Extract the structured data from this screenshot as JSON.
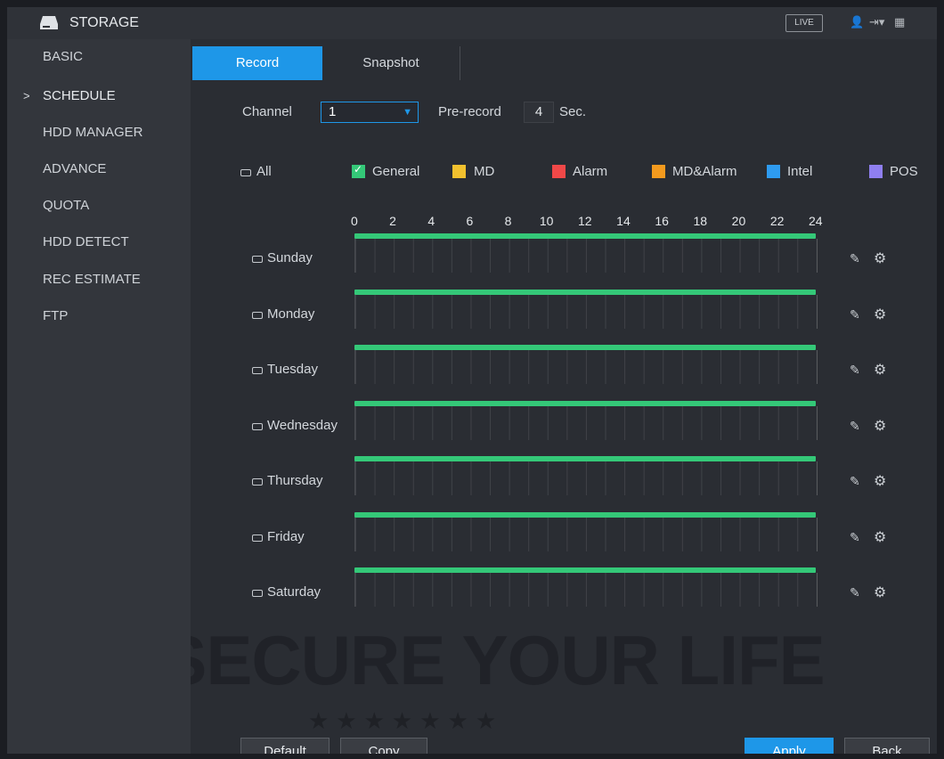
{
  "titlebar": {
    "title": "STORAGE",
    "live_label": "LIVE"
  },
  "sidebar": {
    "items": [
      {
        "label": "BASIC"
      },
      {
        "label": "SCHEDULE",
        "active": true
      },
      {
        "label": "HDD MANAGER"
      },
      {
        "label": "ADVANCE"
      },
      {
        "label": "QUOTA"
      },
      {
        "label": "HDD DETECT"
      },
      {
        "label": "REC ESTIMATE"
      },
      {
        "label": "FTP"
      }
    ],
    "active_marker": ">"
  },
  "tabs": [
    {
      "label": "Record",
      "active": true
    },
    {
      "label": "Snapshot"
    }
  ],
  "controls": {
    "channel_label": "Channel",
    "channel_value": "1",
    "prerecord_label": "Pre-record",
    "prerecord_value": "4",
    "prerecord_unit": "Sec."
  },
  "legend": {
    "all_label": "All",
    "items": [
      {
        "label": "General",
        "color": "#34c878",
        "checked": true
      },
      {
        "label": "MD",
        "color": "#f2c12e"
      },
      {
        "label": "Alarm",
        "color": "#f04848"
      },
      {
        "label": "MD&Alarm",
        "color": "#f39a1e"
      },
      {
        "label": "Intel",
        "color": "#2e9bf0"
      },
      {
        "label": "POS",
        "color": "#8f7ff0"
      }
    ]
  },
  "timeline": {
    "ticks": [
      "0",
      "2",
      "4",
      "6",
      "8",
      "10",
      "12",
      "14",
      "16",
      "18",
      "20",
      "22",
      "24"
    ],
    "days": [
      "Sunday",
      "Monday",
      "Tuesday",
      "Wednesday",
      "Thursday",
      "Friday",
      "Saturday"
    ],
    "record_type": "General",
    "range_hours": [
      0,
      24
    ]
  },
  "buttons": {
    "default": "Default",
    "copy": "Copy",
    "apply": "Apply",
    "back": "Back"
  },
  "colors": {
    "accent": "#1e97e8",
    "general": "#34c878"
  },
  "watermark": {
    "text": "WE SECURE YOUR LIFE",
    "stars": "★★★★★★★"
  }
}
